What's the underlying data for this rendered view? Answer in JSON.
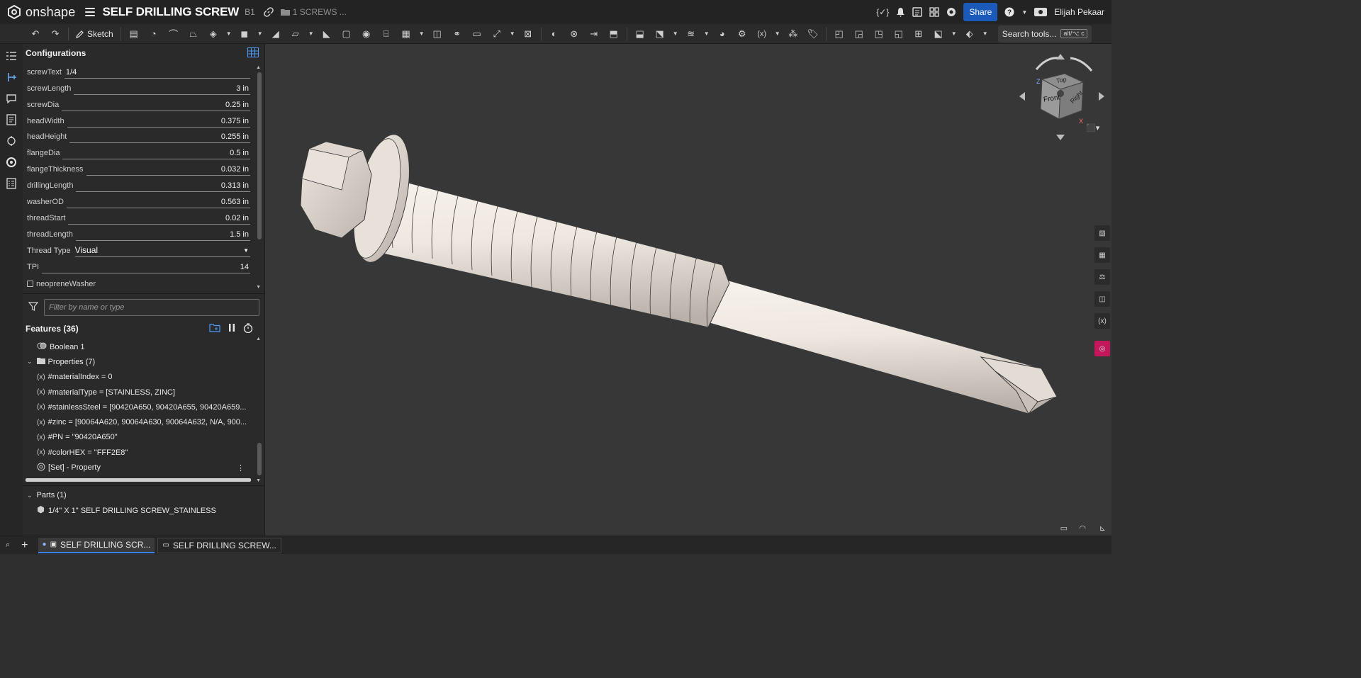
{
  "topbar": {
    "app_name": "onshape",
    "doc_title": "SELF DRILLING SCREW",
    "version": "B1",
    "folder": "1 SCREWS ...",
    "share_label": "Share",
    "user_name": "Elijah Pekaar"
  },
  "toolbar": {
    "sketch_label": "Sketch",
    "search_tools_label": "Search tools...",
    "search_shortcut": "alt/⌥ c"
  },
  "config": {
    "title": "Configurations",
    "rows": [
      {
        "label": "screwText",
        "value": "1/4"
      },
      {
        "label": "screwLength",
        "value": "3 in"
      },
      {
        "label": "screwDia",
        "value": "0.25 in"
      },
      {
        "label": "headWidth",
        "value": "0.375 in"
      },
      {
        "label": "headHeight",
        "value": "0.255 in"
      },
      {
        "label": "flangeDia",
        "value": "0.5 in"
      },
      {
        "label": "flangeThickness",
        "value": "0.032 in"
      },
      {
        "label": "drillingLength",
        "value": "0.313 in"
      },
      {
        "label": "washerOD",
        "value": "0.563 in"
      },
      {
        "label": "threadStart",
        "value": "0.02 in"
      },
      {
        "label": "threadLength",
        "value": "1.5 in"
      }
    ],
    "thread_type_label": "Thread Type",
    "thread_type_value": "Visual",
    "tpi_label": "TPI",
    "tpi_value": "14",
    "neoprene_label": "neopreneWasher"
  },
  "features": {
    "filter_placeholder": "Filter by name or type",
    "title": "Features (36)",
    "items": [
      {
        "label": "Boolean 1"
      },
      {
        "label": "Properties (7)"
      },
      {
        "label": "#materialIndex = 0"
      },
      {
        "label": "#materialType = [STAINLESS, ZINC]"
      },
      {
        "label": "#stainlessSteel = [90420A650, 90420A655, 90420A659..."
      },
      {
        "label": "#zinc = [90064A620, 90064A630, 90064A632, N/A, 900..."
      },
      {
        "label": "#PN = \"90420A650\""
      },
      {
        "label": "#colorHEX = \"FFF2E8\""
      },
      {
        "label": "[Set] - Property"
      }
    ],
    "parts_title": "Parts (1)",
    "part_name": "1/4\" X 1\" SELF DRILLING SCREW_STAINLESS"
  },
  "viewcube": {
    "top": "Top",
    "front": "Front",
    "right": "Right",
    "axis_z": "Z",
    "axis_x": "X"
  },
  "tabs": [
    {
      "label": "SELF DRILLING SCR..."
    },
    {
      "label": "SELF DRILLING SCREW..."
    }
  ],
  "colors": {
    "share": "#1b5ab8",
    "screw": "#e9e2db",
    "background": "#373737"
  }
}
